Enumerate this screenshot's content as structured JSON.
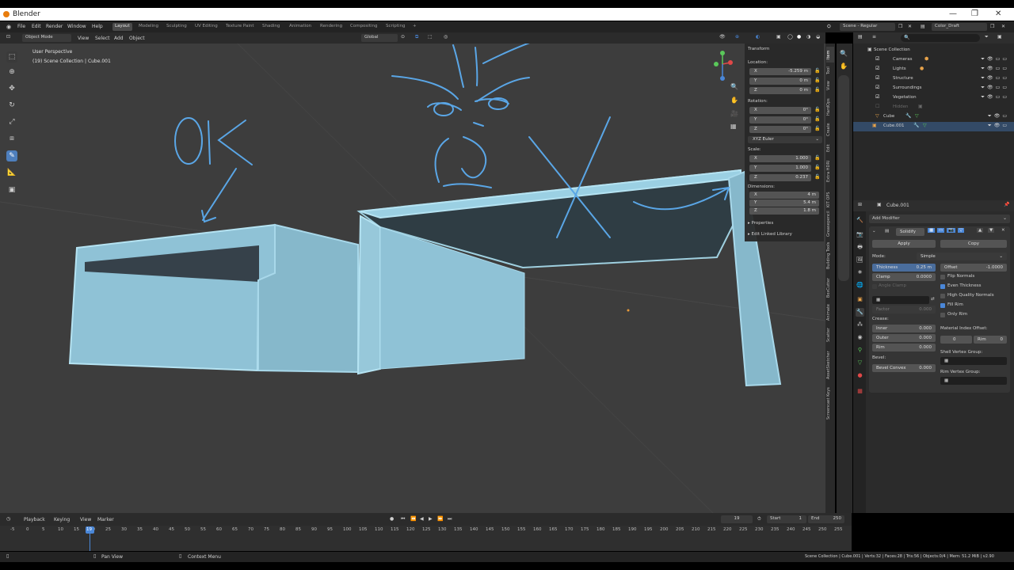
{
  "titlebar": {
    "title": "Blender",
    "min": "—",
    "max": "❐",
    "close": "✕"
  },
  "menus": [
    "File",
    "Edit",
    "Render",
    "Window",
    "Help"
  ],
  "workspaces": [
    "Layout",
    "Modeling",
    "Sculpting",
    "UV Editing",
    "Texture Paint",
    "Shading",
    "Animation",
    "Rendering",
    "Compositing",
    "Scripting"
  ],
  "add_workspace": "+",
  "scene": {
    "label": "Scene - Regular",
    "view_layer": "Color_Draft"
  },
  "viewport_header": {
    "mode": "Object Mode",
    "menus": [
      "View",
      "Select",
      "Add",
      "Object"
    ],
    "orientation": "Global"
  },
  "viewport": {
    "perspective": "User Perspective",
    "collection": "(19) Scene Collection | Cube.001",
    "annotation_ok": "OK"
  },
  "transform": {
    "title": "Transform",
    "location_label": "Location:",
    "location": [
      [
        "X",
        "-5.259 m"
      ],
      [
        "Y",
        "0 m"
      ],
      [
        "Z",
        "0 m"
      ]
    ],
    "rotation_label": "Rotation:",
    "rotation": [
      [
        "X",
        "0°"
      ],
      [
        "Y",
        "0°"
      ],
      [
        "Z",
        "0°"
      ]
    ],
    "rotation_mode": "XYZ Euler",
    "scale_label": "Scale:",
    "scale": [
      [
        "X",
        "1.000"
      ],
      [
        "Y",
        "1.000"
      ],
      [
        "Z",
        "0.237"
      ]
    ],
    "dimensions_label": "Dimensions:",
    "dimensions": [
      [
        "X",
        "4 m"
      ],
      [
        "Y",
        "5.4 m"
      ],
      [
        "Z",
        "1.8 m"
      ]
    ],
    "properties": "Properties",
    "edit_linked": "Edit Linked Library"
  },
  "side_tabs": [
    "Item",
    "Tool",
    "View",
    "HardOps",
    "Create",
    "Edit",
    "Extra HDRI",
    "KIT OPS",
    "Greasepencil",
    "Building Tools",
    "BoxCutter",
    "Animate",
    "Scatter",
    "AssetSketcher",
    "Screencast Keys"
  ],
  "outliner": {
    "root": "Scene Collection",
    "items": [
      {
        "name": "Cameras",
        "indent": 1
      },
      {
        "name": "Lights",
        "indent": 1
      },
      {
        "name": "Structure",
        "indent": 1
      },
      {
        "name": "Surroundings",
        "indent": 1
      },
      {
        "name": "Vegetation",
        "indent": 1
      },
      {
        "name": "Hidden",
        "indent": 1
      },
      {
        "name": "Cube",
        "indent": 0
      },
      {
        "name": "Cube.001",
        "indent": 0
      }
    ]
  },
  "properties": {
    "object": "Cube.001",
    "add_modifier": "Add Modifier",
    "modifier_name": "Solidify",
    "apply": "Apply",
    "copy": "Copy",
    "mode_label": "Mode:",
    "mode_value": "Simple",
    "thickness": [
      "Thickness",
      "0.25 m"
    ],
    "offset": [
      "Offset",
      "-1.0000"
    ],
    "clamp": [
      "Clamp",
      "0.0000"
    ],
    "angle_clamp": "Angle Clamp",
    "flip_normals": "Flip Normals",
    "even_thickness": "Even Thickness",
    "high_quality_normals": "High Quality Normals",
    "fill_rim": "Fill Rim",
    "only_rim": "Only Rim",
    "factor": [
      "Factor",
      "0.000"
    ],
    "crease_label": "Crease:",
    "inner": [
      "Inner",
      "0.000"
    ],
    "outer": [
      "Outer",
      "0.000"
    ],
    "rim": [
      "Rim",
      "0.000"
    ],
    "material_index_label": "Material Index Offset:",
    "mat_offset": "0",
    "mat_rim": [
      "Rim",
      "0"
    ],
    "shell_vertex_group": "Shell Vertex Group:",
    "bevel_label": "Bevel:",
    "bevel_convex": [
      "Bevel Convex",
      "0.000"
    ],
    "rim_vertex_group": "Rim Vertex Group:"
  },
  "timeline": {
    "menus": [
      "Playback",
      "Keying",
      "View",
      "Marker"
    ],
    "current_frame": "19",
    "start_label": "Start",
    "start": "1",
    "end_label": "End",
    "end": "250",
    "ticks": [
      "-5",
      "0",
      "5",
      "10",
      "15",
      "19",
      "20",
      "25",
      "30",
      "35",
      "40",
      "45",
      "50",
      "55",
      "60",
      "65",
      "70",
      "75",
      "80",
      "85",
      "90",
      "95",
      "100",
      "105",
      "110",
      "115",
      "120",
      "125",
      "130",
      "135",
      "140",
      "145",
      "150",
      "155",
      "160",
      "165",
      "170",
      "175",
      "180",
      "185",
      "190",
      "195",
      "200",
      "205",
      "210",
      "215",
      "220",
      "225",
      "230",
      "235",
      "240",
      "245",
      "250",
      "255"
    ]
  },
  "status": {
    "pan": "Pan View",
    "context": "Context Menu",
    "info": "Scene Collection | Cube.001 | Verts:32 | Faces:28 | Tris:56 | Objects:0/4 | Mem: 51.2 MiB | v2.90"
  },
  "colors": {
    "accent": "#4a87d8",
    "mesh": "#9fd0e0",
    "annotation": "#5aa6e6"
  }
}
